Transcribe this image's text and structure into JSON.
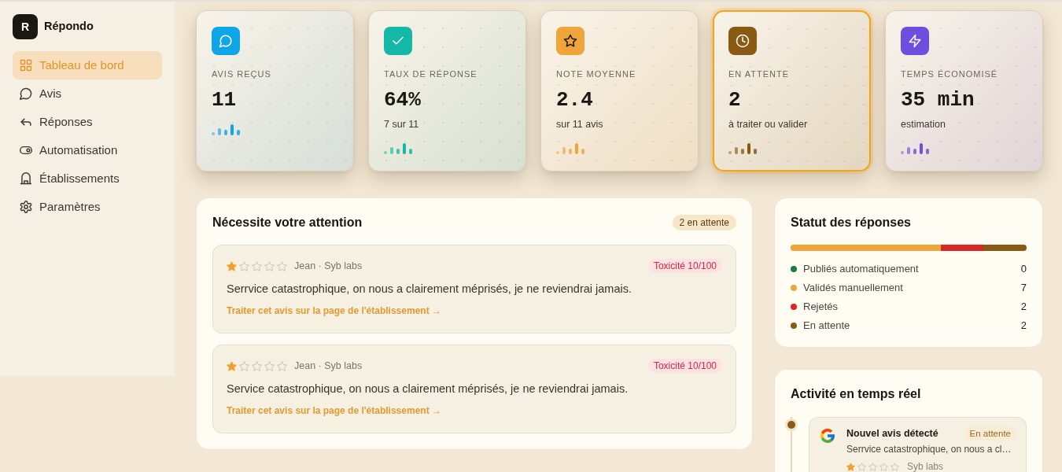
{
  "sidebar": {
    "logo": "R",
    "brand": "Répondo",
    "items": [
      {
        "label": "Tableau de bord",
        "selected": true
      },
      {
        "label": "Avis",
        "selected": false
      },
      {
        "label": "Réponses",
        "selected": false
      },
      {
        "label": "Automatisation",
        "selected": false
      },
      {
        "label": "Établissements",
        "selected": false
      },
      {
        "label": "Paramètres",
        "selected": false
      }
    ]
  },
  "stats": [
    {
      "label": "AVIS REÇUS",
      "value": "11",
      "color": "#0ea5e9",
      "highlighted": false
    },
    {
      "label": "TAUX DE RÉPONSE",
      "value": "64%",
      "caption": "7 sur 11",
      "color": "#14b8a6",
      "highlighted": false
    },
    {
      "label": "NOTE MOYENNE",
      "value": "2.4",
      "caption": "sur 11 avis",
      "color": "#f0a53a",
      "highlighted": false
    },
    {
      "label": "EN ATTENTE",
      "value": "2",
      "caption": "à traiter ou valider",
      "color": "#8b5a12",
      "highlighted": true
    },
    {
      "label": "TEMPS ÉCONOMISÉ",
      "value": "35 min",
      "caption": "estimation",
      "color": "#6d4fe0",
      "highlighted": false
    }
  ],
  "attention": {
    "title": "Nécessite votre attention",
    "badge": "2 en attente",
    "reviews": [
      {
        "stars": 1,
        "meta": "Jean · Syb labs",
        "toxicity": "Toxicité 10/100",
        "text": "Serrvice catastrophique, on nous a clairement méprisés, je ne reviendrai jamais.",
        "link": "Traiter cet avis sur la page de l'établissement →"
      },
      {
        "stars": 1,
        "meta": "Jean · Syb labs",
        "toxicity": "Toxicité 10/100",
        "text": "Service catastrophique, on nous a clairement méprisés, je ne reviendrai jamais.",
        "link": "Traiter cet avis sur la page de l'établissement →"
      }
    ]
  },
  "status": {
    "title": "Statut des réponses",
    "items": [
      {
        "label": "Publiés automatiquement",
        "count": "0",
        "color": "#15803d"
      },
      {
        "label": "Validés manuellement",
        "count": "7",
        "color": "#f0a53a"
      },
      {
        "label": "Rejetés",
        "count": "2",
        "color": "#dc2626"
      },
      {
        "label": "En attente",
        "count": "2",
        "color": "#8b5a12"
      }
    ]
  },
  "activity": {
    "title": "Activité en temps réel",
    "events": [
      {
        "title": "Nouvel avis détecté",
        "status": "En attente",
        "text": "Serrvice catastrophique, on nous a cl…",
        "stars": 1,
        "source": "Syb labs"
      }
    ]
  }
}
